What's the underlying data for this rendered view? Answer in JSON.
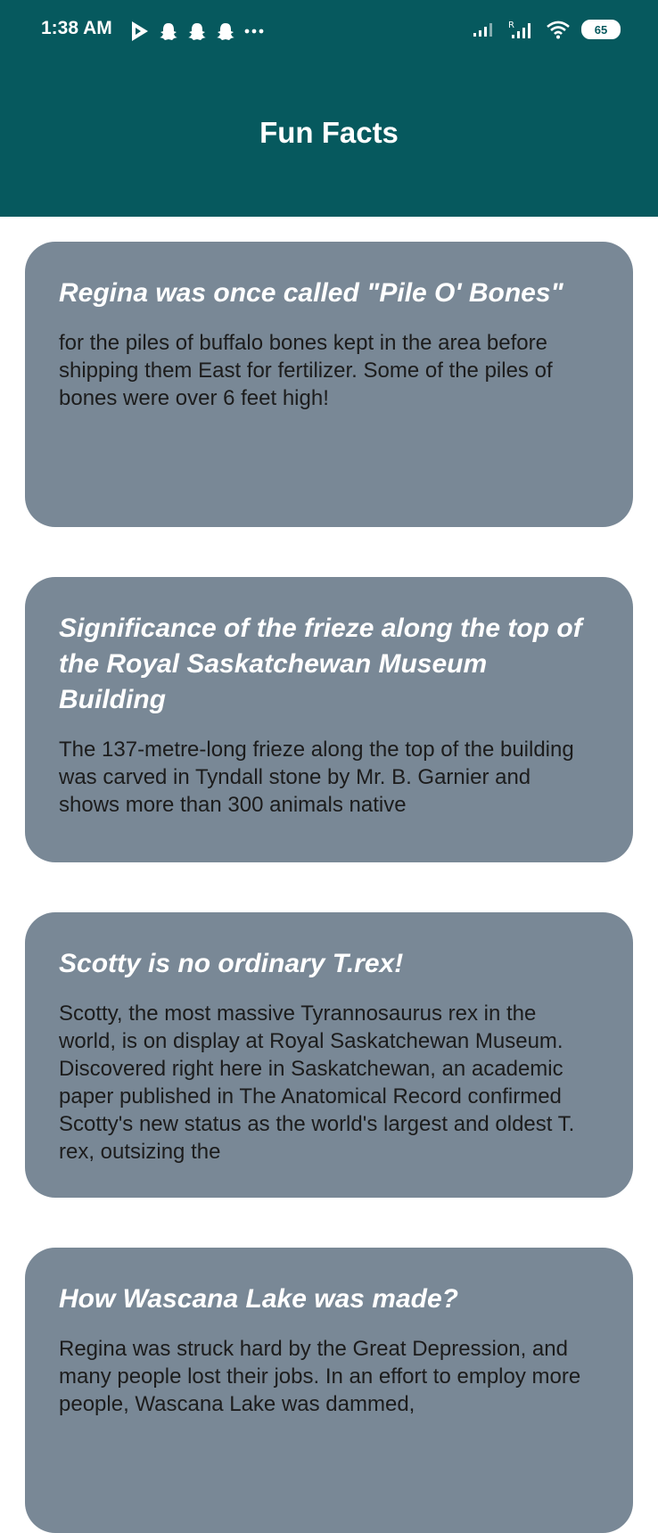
{
  "status_bar": {
    "time": "1:38 AM",
    "battery": "65",
    "icons": [
      "play-store-icon",
      "snapchat-icon",
      "snapchat-icon",
      "snapchat-icon",
      "more-dots-icon"
    ]
  },
  "app_bar": {
    "title": "Fun Facts"
  },
  "facts": [
    {
      "title": "Regina was once called \"Pile O' Bones\"",
      "body": "for the piles of buffalo bones kept in the area before shipping them East for fertilizer. Some of the piles of bones were over 6 feet high!"
    },
    {
      "title": "Significance of the frieze along the top of the Royal Saskatchewan Museum Building",
      "body": "The 137-metre-long frieze along the top of the building was carved in Tyndall stone by Mr. B. Garnier and shows more than 300 animals native"
    },
    {
      "title": "Scotty is no ordinary T.rex!",
      "body": "Scotty, the most massive Tyrannosaurus rex in the world, is on display at Royal Saskatchewan Museum. Discovered right here in Saskatchewan, an academic paper published in The Anatomical Record confirmed Scotty's new status as the world's largest and oldest T. rex, outsizing the"
    },
    {
      "title": "How Wascana Lake was made?",
      "body": "Regina was struck hard by the Great Depression, and many people lost their jobs. In an effort to employ more people, Wascana Lake was dammed,"
    }
  ]
}
